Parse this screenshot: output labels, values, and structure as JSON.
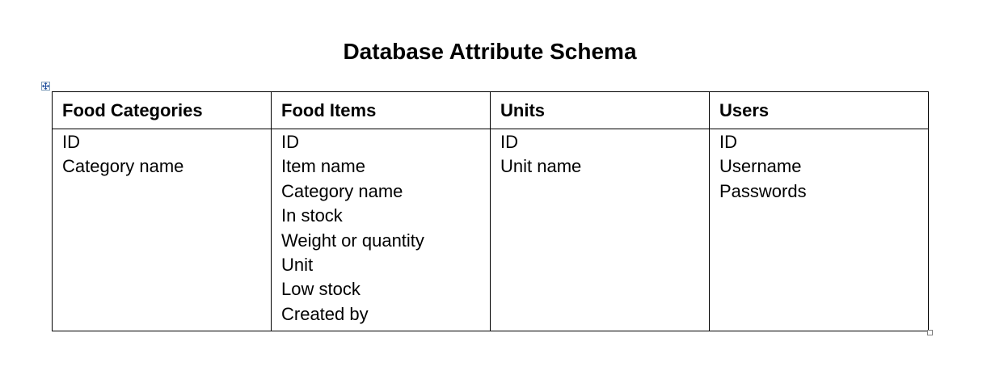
{
  "document": {
    "title": "Database Attribute Schema"
  },
  "table": {
    "columns": [
      {
        "header": "Food Categories",
        "attributes": [
          "ID",
          "Category name"
        ]
      },
      {
        "header": "Food Items",
        "attributes": [
          "ID",
          "Item name",
          "Category name",
          "In stock",
          "Weight or quantity",
          "Unit",
          "Low stock",
          "Created by"
        ]
      },
      {
        "header": "Units",
        "attributes": [
          "ID",
          "Unit name"
        ]
      },
      {
        "header": "Users",
        "attributes": [
          "ID",
          "Username",
          "Passwords"
        ]
      }
    ]
  },
  "icons": {
    "table_move_handle": "move-cross-icon",
    "table_resize_handle": "resize-square-icon"
  },
  "colors": {
    "text": "#000000",
    "border": "#000000",
    "handle_border": "#7f9db9"
  }
}
